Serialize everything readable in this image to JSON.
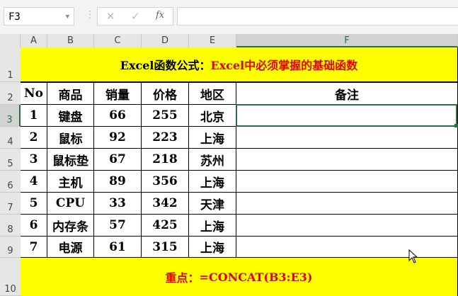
{
  "name_box": "F3",
  "formula_bar": {
    "cancel": "✕",
    "enter": "✓",
    "fx": "fx",
    "value": ""
  },
  "columns": [
    "A",
    "B",
    "C",
    "D",
    "E",
    "F"
  ],
  "rows": [
    "1",
    "2",
    "3",
    "4",
    "5",
    "6",
    "7",
    "8",
    "9",
    "10"
  ],
  "title": {
    "black": "Excel函数公式：",
    "red": "Excel中必须掌握的基础函数"
  },
  "headers": [
    "No",
    "商品",
    "销量",
    "价格",
    "地区",
    "备注"
  ],
  "data": [
    [
      "1",
      "键盘",
      "66",
      "255",
      "北京",
      ""
    ],
    [
      "2",
      "鼠标",
      "92",
      "223",
      "上海",
      ""
    ],
    [
      "3",
      "鼠标垫",
      "67",
      "218",
      "苏州",
      ""
    ],
    [
      "4",
      "主机",
      "89",
      "356",
      "上海",
      ""
    ],
    [
      "5",
      "CPU",
      "33",
      "342",
      "天津",
      ""
    ],
    [
      "6",
      "内存条",
      "57",
      "425",
      "上海",
      ""
    ],
    [
      "7",
      "电源",
      "61",
      "315",
      "上海",
      ""
    ]
  ],
  "footer": {
    "label": "重点：",
    "formula": "=CONCAT(B3:E3)"
  },
  "colors": {
    "accent": "#217346",
    "highlight": "#ffff00",
    "red": "#e00000"
  }
}
